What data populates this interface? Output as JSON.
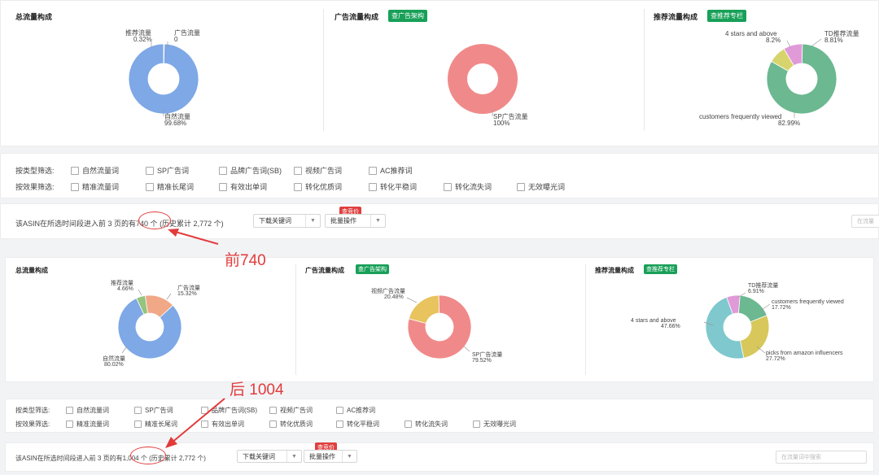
{
  "colors": {
    "natural": "#7ea8e6",
    "ad_total": "#f0a887",
    "rec_total": "#94c47e",
    "sp": "#f08a8a",
    "video": "#e8c35e",
    "stars": "#d7d46d",
    "td": "#e09ad8",
    "customers": "#6bb891",
    "amazon": "#d8c75b",
    "stars_b": "#7ec8ce",
    "accent_green": "#18a058",
    "annotation_red": "#e23b3b"
  },
  "top": {
    "total": {
      "title": "总流量构成",
      "slices": [
        {
          "name": "自然流量",
          "pct": "99.68%",
          "value": 99.68,
          "color_key": "natural"
        },
        {
          "name": "推荐流量",
          "pct": "0.32%",
          "value": 0.32,
          "color_key": "rec_total"
        },
        {
          "name": "广告流量",
          "pct": "0",
          "value": 0,
          "color_key": "ad_total"
        }
      ]
    },
    "ad": {
      "title": "广告流量构成",
      "button": "查广告架构",
      "slices": [
        {
          "name": "SP广告流量",
          "pct": "100%",
          "value": 100,
          "color_key": "sp"
        }
      ]
    },
    "rec": {
      "title": "推荐流量构成",
      "button": "查推荐专栏",
      "slices": [
        {
          "name": "customers frequently viewed",
          "pct": "82.99%",
          "value": 82.99,
          "color_key": "customers"
        },
        {
          "name": "4 stars and above",
          "pct": "8.2%",
          "value": 8.2,
          "color_key": "stars"
        },
        {
          "name": "TD推荐流量",
          "pct": "8.81%",
          "value": 8.81,
          "color_key": "td"
        }
      ]
    }
  },
  "bottom": {
    "total": {
      "title": "总流量构成",
      "slices": [
        {
          "name": "自然流量",
          "pct": "80.02%",
          "value": 80.02,
          "color_key": "natural"
        },
        {
          "name": "推荐流量",
          "pct": "4.66%",
          "value": 4.66,
          "color_key": "rec_total"
        },
        {
          "name": "广告流量",
          "pct": "15.32%",
          "value": 15.32,
          "color_key": "ad_total"
        }
      ]
    },
    "ad": {
      "title": "广告流量构成",
      "button": "查广告架构",
      "slices": [
        {
          "name": "SP广告流量",
          "pct": "79.52%",
          "value": 79.52,
          "color_key": "sp"
        },
        {
          "name": "视频广告流量",
          "pct": "20.48%",
          "value": 20.48,
          "color_key": "video"
        }
      ]
    },
    "rec": {
      "title": "推荐流量构成",
      "button": "查推荐专栏",
      "slices": [
        {
          "name": "customers frequently viewed",
          "pct": "17.72%",
          "value": 17.72,
          "color_key": "customers"
        },
        {
          "name": "picks from amazon influencers",
          "pct": "27.72%",
          "value": 27.72,
          "color_key": "amazon"
        },
        {
          "name": "4 stars and above",
          "pct": "47.66%",
          "value": 47.66,
          "color_key": "stars_b"
        },
        {
          "name": "TD推荐流量",
          "pct": "6.91%",
          "value": 6.91,
          "color_key": "td"
        }
      ]
    }
  },
  "filters": {
    "type_label": "按类型筛选:",
    "type_options": [
      "自然流量词",
      "SP广告词",
      "品牌广告词(SB)",
      "视频广告词",
      "AC推荐词"
    ],
    "effect_label": "按效果筛选:",
    "effect_options": [
      "精准流量词",
      "精准长尾词",
      "有效出单词",
      "转化优质词",
      "转化平稳词",
      "转化流失词",
      "无效曝光词"
    ]
  },
  "status1": {
    "prefix": "该ASIN在所选时间段进入前 3 页的有",
    "count": "740 个",
    "history": "(历史累计 2,772 个)",
    "download": "下载关键词",
    "batch": "批量操作",
    "badge": "查竞价",
    "search_placeholder": "在流量"
  },
  "status2": {
    "prefix": "该ASIN在所选时间段进入前 3 页的有",
    "count": "1,004 个",
    "history": "(历史累计 2,772 个)",
    "download": "下载关键词",
    "batch": "批量操作",
    "badge": "查竞价",
    "search_placeholder": "在流量词中搜索"
  },
  "annotations": {
    "front": "前740",
    "back": "后 1004"
  }
}
